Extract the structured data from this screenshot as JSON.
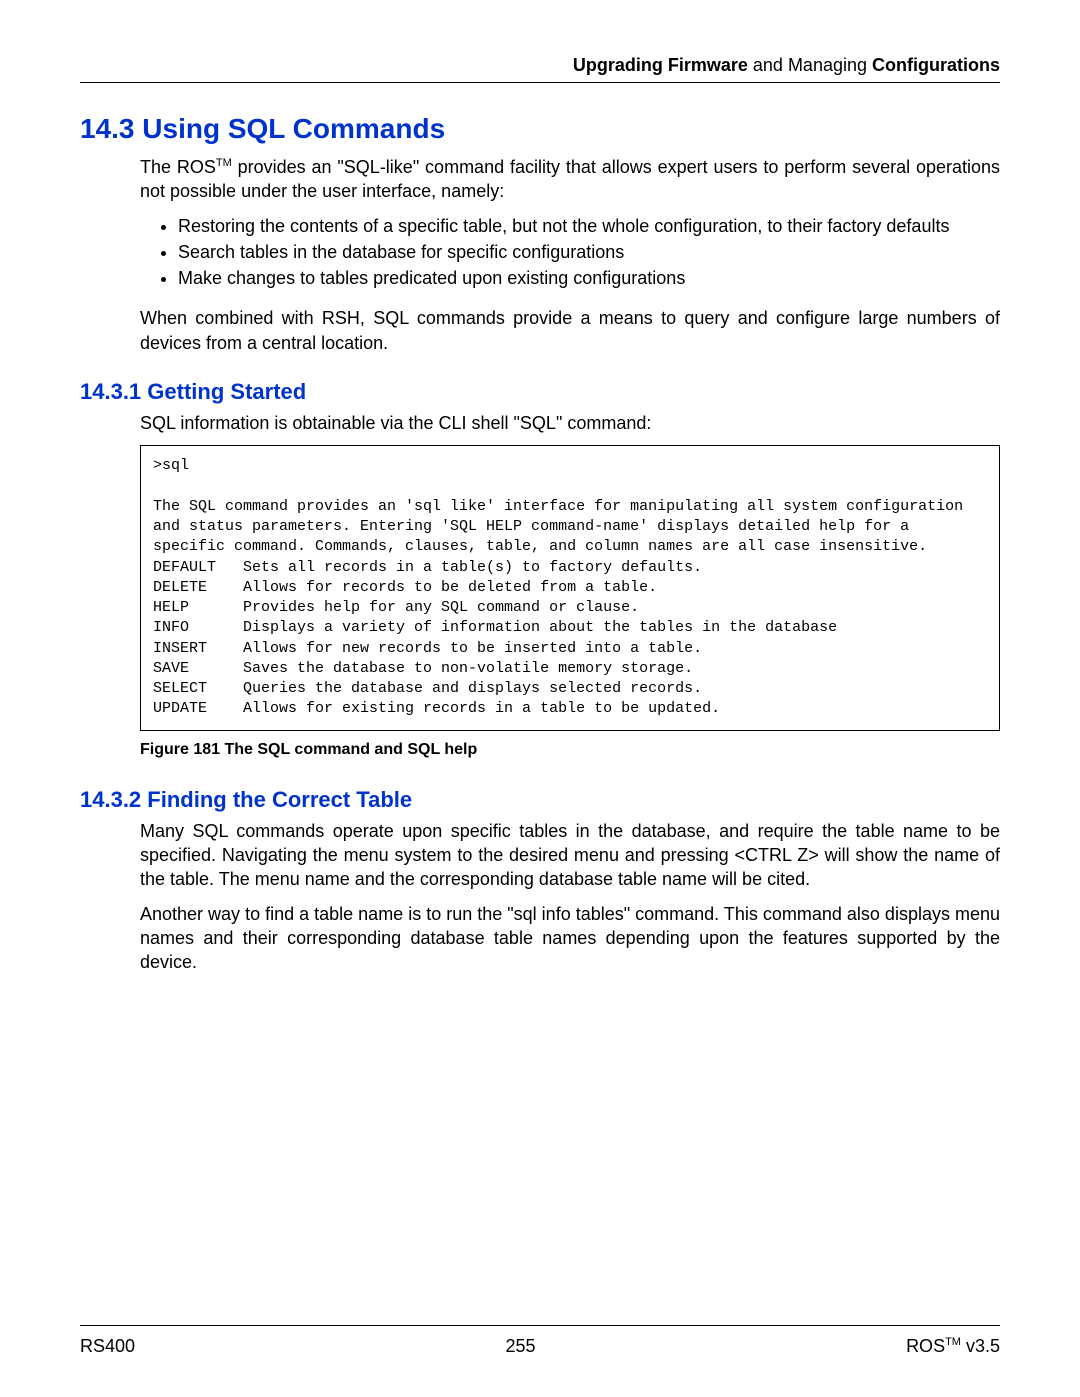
{
  "header": {
    "left_bold": "Upgrading Firmware",
    "mid_plain": " and Managing ",
    "right_bold": "Configurations"
  },
  "section": {
    "num": "14.3",
    "title": "Using SQL Commands"
  },
  "intro": {
    "p1_pre": "The ROS",
    "p1_tm": "TM",
    "p1_post": " provides an \"SQL-like\" command facility that allows expert users to perform several operations not possible under the user interface, namely:"
  },
  "bullets": [
    "Restoring the contents of a specific table, but not the whole configuration, to their factory defaults",
    "Search tables in the database for specific configurations",
    "Make changes to tables predicated upon existing configurations"
  ],
  "intro2": "When combined with RSH, SQL commands provide a means to query and configure large numbers of devices from a central location.",
  "sub1": {
    "num": "14.3.1",
    "title": "Getting Started",
    "p1": "SQL information is obtainable via the CLI shell \"SQL\" command:"
  },
  "codebox": ">sql\n\nThe SQL command provides an 'sql like' interface for manipulating all system configuration and status parameters. Entering 'SQL HELP command-name' displays detailed help for a specific command. Commands, clauses, table, and column names are all case insensitive.\nDEFAULT   Sets all records in a table(s) to factory defaults.\nDELETE    Allows for records to be deleted from a table.\nHELP      Provides help for any SQL command or clause.\nINFO      Displays a variety of information about the tables in the database\nINSERT    Allows for new records to be inserted into a table.\nSAVE      Saves the database to non-volatile memory storage.\nSELECT    Queries the database and displays selected records.\nUPDATE    Allows for existing records in a table to be updated.\n",
  "figcaption": "Figure 181 The SQL command and SQL help",
  "sub2": {
    "num": "14.3.2",
    "title": "Finding the Correct Table",
    "p1": "Many SQL commands operate upon specific tables in the database, and require the table name to be specified. Navigating the menu system to the desired menu and pressing <CTRL Z> will show the name of the table. The menu name and the corresponding database table name will be cited.",
    "p2": "Another way to find a table name is to run the \"sql info tables\" command. This command also displays menu names and their corresponding database table names depending upon the features supported by the device."
  },
  "footer": {
    "left": "RS400",
    "center": "255",
    "right_pre": "ROS",
    "right_tm": "TM",
    "right_post": "  v3.5"
  }
}
